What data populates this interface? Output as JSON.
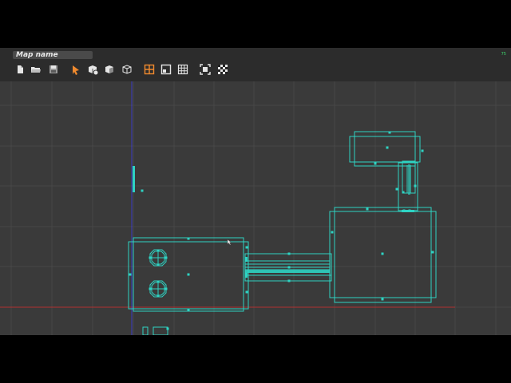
{
  "toolbar": {
    "map_name": "Map name",
    "fps": "75",
    "tools": [
      {
        "icon": "new-file-icon"
      },
      {
        "icon": "open-folder-icon"
      },
      {
        "icon": "save-icon"
      },
      {
        "icon": "select-arrow-icon"
      },
      {
        "icon": "add-brush-icon"
      },
      {
        "icon": "brush-face-icon"
      },
      {
        "icon": "wireframe-cube-icon"
      },
      {
        "icon": "quad-view-icon"
      },
      {
        "icon": "single-view-icon"
      },
      {
        "icon": "grid-icon"
      },
      {
        "icon": "focus-frame-icon"
      },
      {
        "icon": "checker-texture-icon"
      }
    ]
  },
  "colors": {
    "background": "#3a3a3a",
    "toolbar": "#2c2c2c",
    "grid": "#4a4a4a",
    "brush_outline": "#2ed3c3",
    "accent_orange": "#f08a2e",
    "axis_red": "#b33030",
    "axis_blue": "#3c3cff"
  }
}
